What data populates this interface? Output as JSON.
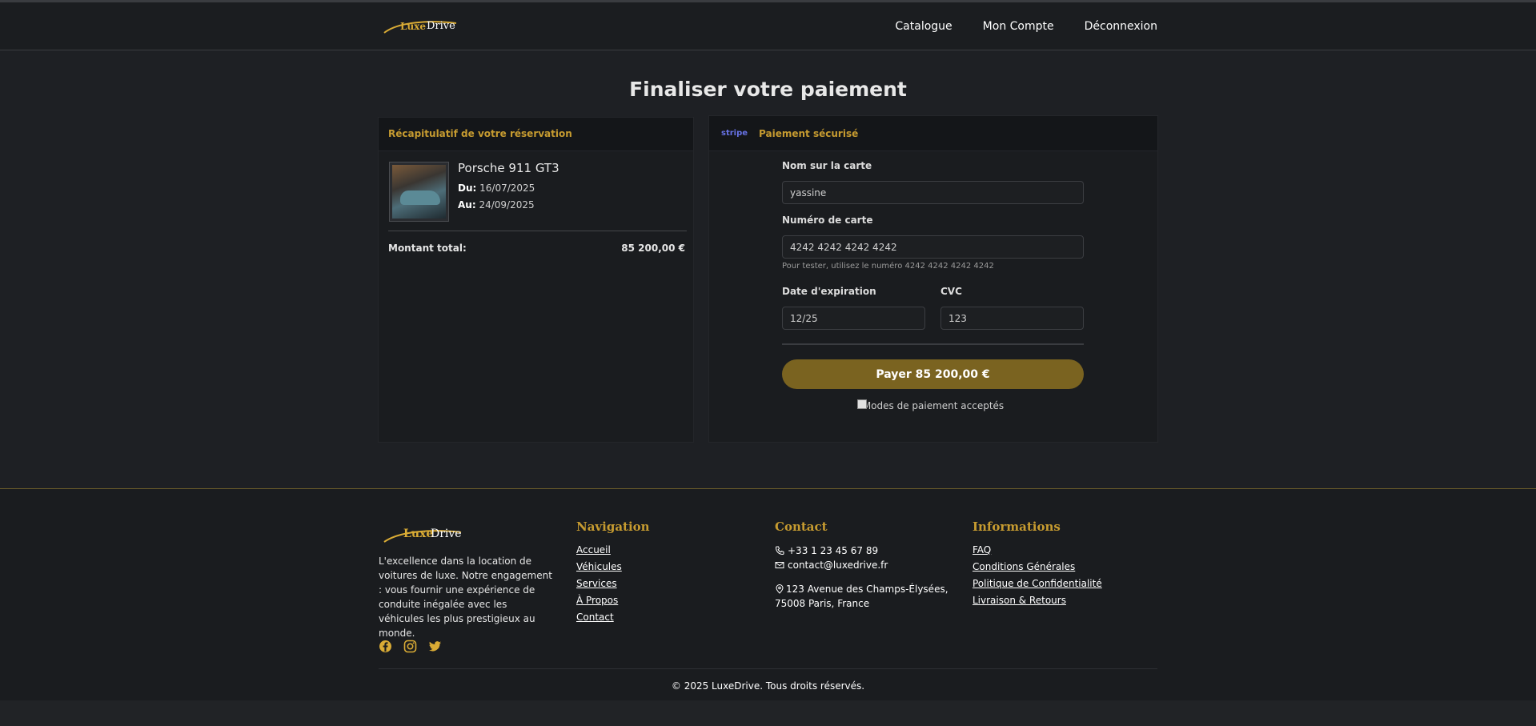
{
  "brand": {
    "luxe": "Luxe",
    "drive": "Drive"
  },
  "nav": {
    "items": [
      "Catalogue",
      "Mon Compte",
      "Déconnexion"
    ]
  },
  "page": {
    "title": "Finaliser votre paiement"
  },
  "summary": {
    "title": "Récapitulatif de votre réservation",
    "car_name": "Porsche 911 GT3",
    "from_label": "Du:",
    "from_date": "16/07/2025",
    "to_label": "Au:",
    "to_date": "24/09/2025",
    "total_label": "Montant total:",
    "total_value": "85 200,00 €"
  },
  "payment": {
    "stripe_logo": "stripe",
    "title": "Paiement sécurisé",
    "name_label": "Nom sur la carte",
    "name_value": "yassine",
    "card_label": "Numéro de carte",
    "card_value": "4242 4242 4242 4242",
    "hint": "Pour tester, utilisez le numéro 4242 4242 4242 4242",
    "expiry_label": "Date d'expiration",
    "expiry_value": "12/25",
    "cvc_label": "CVC",
    "cvc_value": "123",
    "pay_button": "Payer 85 200,00 €",
    "methods_alt": "Modes de paiement acceptés"
  },
  "footer": {
    "about": "L'excellence dans la location de voitures de luxe. Notre engagement : vous fournir une expérience de conduite inégalée avec les véhicules les plus prestigieux au monde.",
    "socials": [
      "facebook-icon",
      "instagram-icon",
      "twitter-icon"
    ],
    "nav_title": "Navigation",
    "nav_links": [
      "Accueil",
      "Véhicules",
      "Services",
      "À Propos",
      "Contact"
    ],
    "contact_title": "Contact",
    "phone": "+33 1 23 45 67 89",
    "email": "contact@luxedrive.fr",
    "address_line1": "123 Avenue des Champs-Élysées,",
    "address_line2": "75008 Paris, France",
    "info_title": "Informations",
    "info_links": [
      "FAQ",
      "Conditions Générales",
      "Politique de Confidentialité",
      "Livraison & Retours"
    ],
    "copyright": "© 2025 LuxeDrive. Tous droits réservés."
  },
  "colors": {
    "accent": "#c69b30",
    "button": "#7a6320",
    "background": "#1e2024"
  }
}
